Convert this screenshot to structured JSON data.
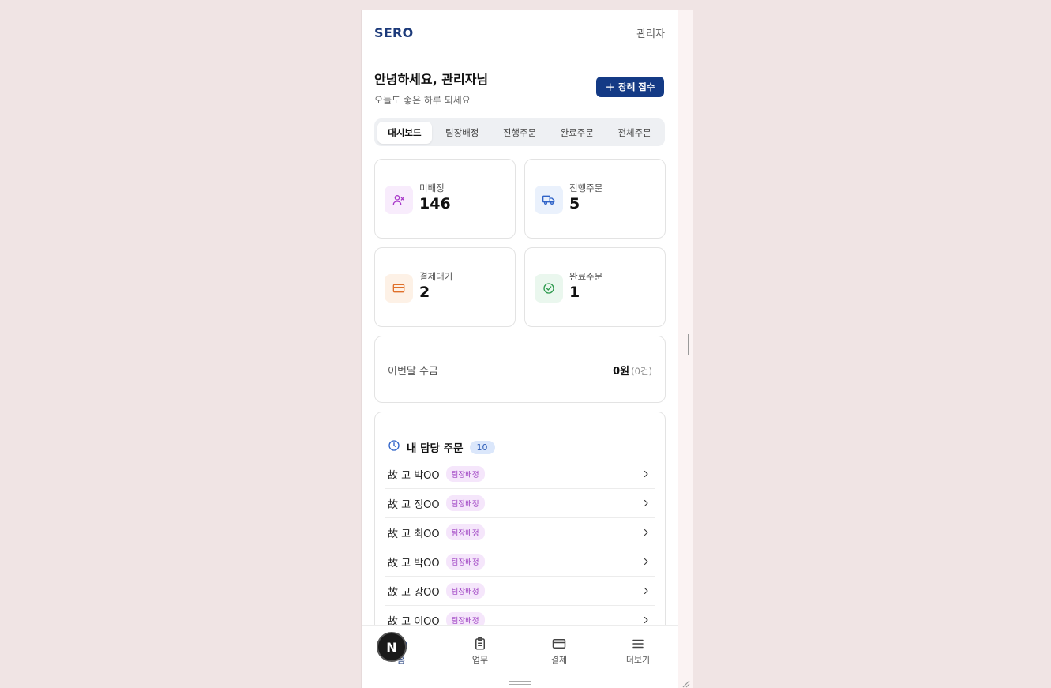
{
  "header": {
    "logo": "SERO",
    "admin_label": "관리자"
  },
  "greeting": {
    "title": "안녕하세요, 관리자님",
    "subtitle": "오늘도 좋은 하루 되세요"
  },
  "register_button": {
    "label": "장례 접수",
    "icon": "plus-icon",
    "color": "#143a85"
  },
  "tabs": [
    {
      "label": "대시보드",
      "active": true
    },
    {
      "label": "팀장배정",
      "active": false
    },
    {
      "label": "진행주문",
      "active": false
    },
    {
      "label": "완료주문",
      "active": false
    },
    {
      "label": "전체주문",
      "active": false
    }
  ],
  "stats": [
    {
      "label": "미배정",
      "value": "146",
      "icon": "user-x-icon",
      "color": "#a838c9"
    },
    {
      "label": "진행주문",
      "value": "5",
      "icon": "truck-icon",
      "color": "#2f63c8"
    },
    {
      "label": "결제대기",
      "value": "2",
      "icon": "credit-card-icon",
      "color": "#e0702a"
    },
    {
      "label": "완료주문",
      "value": "1",
      "icon": "check-circle-icon",
      "color": "#2e9a4e"
    }
  ],
  "revenue": {
    "label": "이번달 수금",
    "amount": "0원",
    "count": "(0건)"
  },
  "orders": {
    "title": "내 담당 주문",
    "count": "10",
    "icon": "clock-icon",
    "items": [
      {
        "name": "故 고 박OO",
        "status": "팀장배정"
      },
      {
        "name": "故 고 정OO",
        "status": "팀장배정"
      },
      {
        "name": "故 고 최OO",
        "status": "팀장배정"
      },
      {
        "name": "故 고 박OO",
        "status": "팀장배정"
      },
      {
        "name": "故 고 강OO",
        "status": "팀장배정"
      },
      {
        "name": "故 고 이OO",
        "status": "팀장배정"
      }
    ]
  },
  "bottom_nav": [
    {
      "label": "홈",
      "icon": "home-icon",
      "active": true
    },
    {
      "label": "업무",
      "icon": "clipboard-icon",
      "active": false
    },
    {
      "label": "결제",
      "icon": "credit-card-icon",
      "active": false
    },
    {
      "label": "더보기",
      "icon": "menu-icon",
      "active": false
    }
  ],
  "floating_badge": {
    "letter": "N"
  }
}
